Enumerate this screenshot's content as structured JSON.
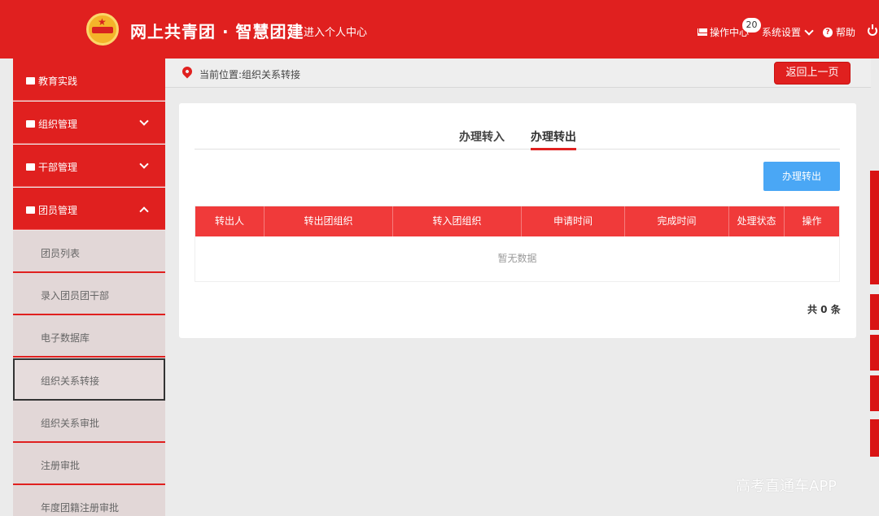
{
  "header": {
    "site_title": "网上共青团 · 智慧团建",
    "personal_center": "进入个人中心",
    "operation_center": "操作中心",
    "badge_count": "20",
    "settings": "系统设置",
    "help": "帮助"
  },
  "sidebar": {
    "main_items": [
      {
        "label": "教育实践"
      },
      {
        "label": "组织管理"
      },
      {
        "label": "干部管理"
      },
      {
        "label": "团员管理"
      }
    ],
    "sub_items": [
      {
        "label": "团员列表"
      },
      {
        "label": "录入团员团干部"
      },
      {
        "label": "电子数据库"
      },
      {
        "label": "组织关系转接"
      },
      {
        "label": "组织关系审批"
      },
      {
        "label": "注册审批"
      },
      {
        "label": "年度团籍注册审批"
      }
    ]
  },
  "breadcrumb": {
    "text": "当前位置:组织关系转接",
    "back_button": "返回上一页"
  },
  "tabs": [
    {
      "label": "办理转入"
    },
    {
      "label": "办理转出"
    }
  ],
  "action_button": "办理转出",
  "table": {
    "headers": [
      "转出人",
      "转出团组织",
      "转入团组织",
      "申请时间",
      "完成时间",
      "处理状态",
      "操作"
    ],
    "empty_text": "暂无数据"
  },
  "total": "共 0 条",
  "watermark": "高考直通车APP",
  "colors": {
    "brand_red": "#e0201f",
    "table_header": "#f03a3a",
    "action_blue": "#4aa7f5"
  }
}
